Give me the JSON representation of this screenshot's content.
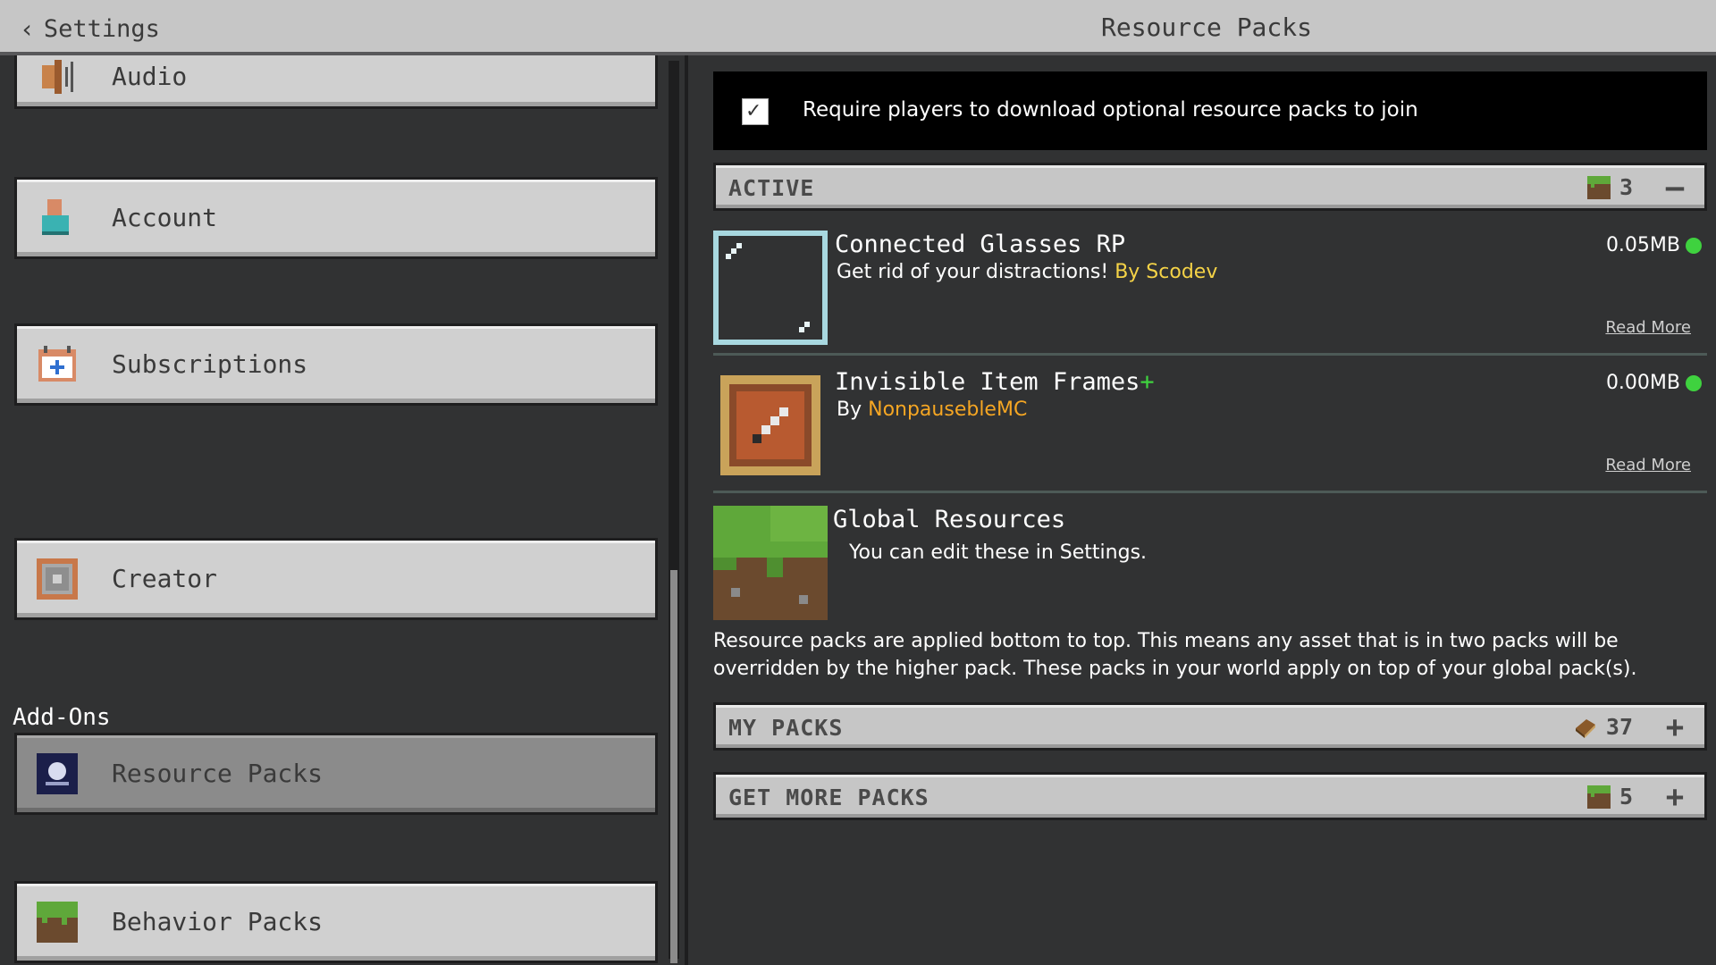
{
  "header": {
    "back_label": "Settings",
    "title": "Resource Packs"
  },
  "sidebar": {
    "items": [
      {
        "label": "Audio",
        "icon": "speaker-icon"
      },
      {
        "label": "Account",
        "icon": "person-icon"
      },
      {
        "label": "Subscriptions",
        "icon": "calendar-plus-icon"
      },
      {
        "label": "Creator",
        "icon": "command-block-icon"
      },
      {
        "label": "Resource Packs",
        "icon": "resource-pack-icon",
        "selected": true
      },
      {
        "label": "Behavior Packs",
        "icon": "grass-block-icon"
      }
    ],
    "section_addons": "Add-Ons"
  },
  "require_option": {
    "checked": true,
    "label": "Require players to download optional resource packs to join"
  },
  "active_section": {
    "label": "ACTIVE",
    "count": "3",
    "toggle": "—"
  },
  "packs": [
    {
      "name": "Connected Glasses RP",
      "desc": "Get rid of your distractions! ",
      "author": "By Scodev",
      "size": "0.05MB",
      "read_more": "Read More"
    },
    {
      "name": "Invisible Item Frames",
      "name_suffix": "+",
      "desc_prefix": "By ",
      "author": "NonpausebleMC",
      "size": "0.00MB",
      "read_more": "Read More"
    },
    {
      "name": "Global Resources",
      "desc": "You can edit these in Settings."
    }
  ],
  "info_text": "Resource packs are applied bottom to top. This means any asset that is in two packs will be overridden by the higher pack. These packs in your world apply on top of your global pack(s).",
  "my_packs": {
    "label": "MY PACKS",
    "count": "37",
    "toggle": "+"
  },
  "get_more": {
    "label": "GET MORE PACKS",
    "count": "5",
    "toggle": "+"
  },
  "colors": {
    "background": "#313233",
    "button": "#d0d0d0",
    "selected_button": "#8b8b8b",
    "author_yellow": "#f5d347",
    "author_orange": "#f5a623",
    "status_green": "#3fd23f"
  }
}
